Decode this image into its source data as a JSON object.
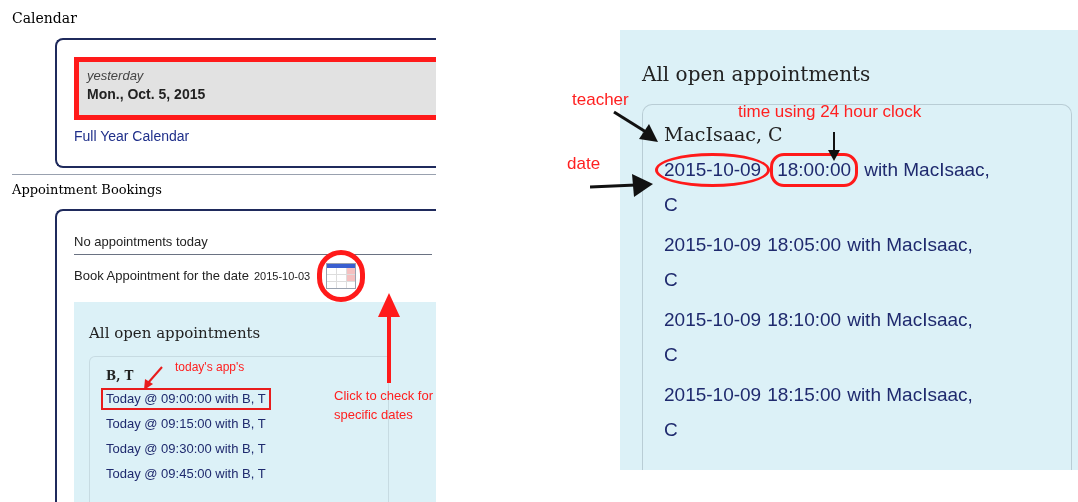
{
  "left": {
    "calendar_heading": "Calendar",
    "today_box": {
      "label": "yesterday",
      "date": "Mon., Oct. 5, 2015",
      "highlighted": true
    },
    "calendar_link": "Full Year Calendar",
    "bookings_heading": "Appointment Bookings",
    "no_appointments": "No appointments today",
    "book_label": "Book Appointment for the date",
    "book_date": "2015-10-03",
    "book_icon_circled": true,
    "open_title": "All open appointments",
    "teacher": "B, T",
    "appointments": [
      {
        "text": "Today @ 09:00:00 with B, T",
        "highlighted": true
      },
      {
        "text": "Today @ 09:15:00 with B, T",
        "highlighted": false
      },
      {
        "text": "Today @ 09:30:00 with B, T",
        "highlighted": false
      },
      {
        "text": "Today @ 09:45:00 with B, T",
        "highlighted": false
      }
    ]
  },
  "right": {
    "open_title": "All open appointments",
    "teacher": "MacIsaac, C",
    "appointments": [
      {
        "date": "2015-10-09",
        "time": "18:00:00",
        "rest": "with MacIsaac,",
        "rest_line2": "C",
        "circled": true
      },
      {
        "date": "2015-10-09",
        "time": "18:05:00",
        "rest": "with MacIsaac,",
        "rest_line2": "C",
        "circled": false
      },
      {
        "date": "2015-10-09",
        "time": "18:10:00",
        "rest": "with MacIsaac,",
        "rest_line2": "C",
        "circled": false
      },
      {
        "date": "2015-10-09",
        "time": "18:15:00",
        "rest": "with MacIsaac,",
        "rest_line2": "C",
        "circled": false
      }
    ]
  },
  "annotations": [
    {
      "kind": "todays",
      "text": "today's app's"
    },
    {
      "kind": "click",
      "text": "Click to check for specific dates"
    },
    {
      "kind": "teacher",
      "text": "teacher"
    },
    {
      "kind": "time",
      "text": "time using 24 hour clock"
    },
    {
      "kind": "date",
      "text": "date"
    }
  ]
}
